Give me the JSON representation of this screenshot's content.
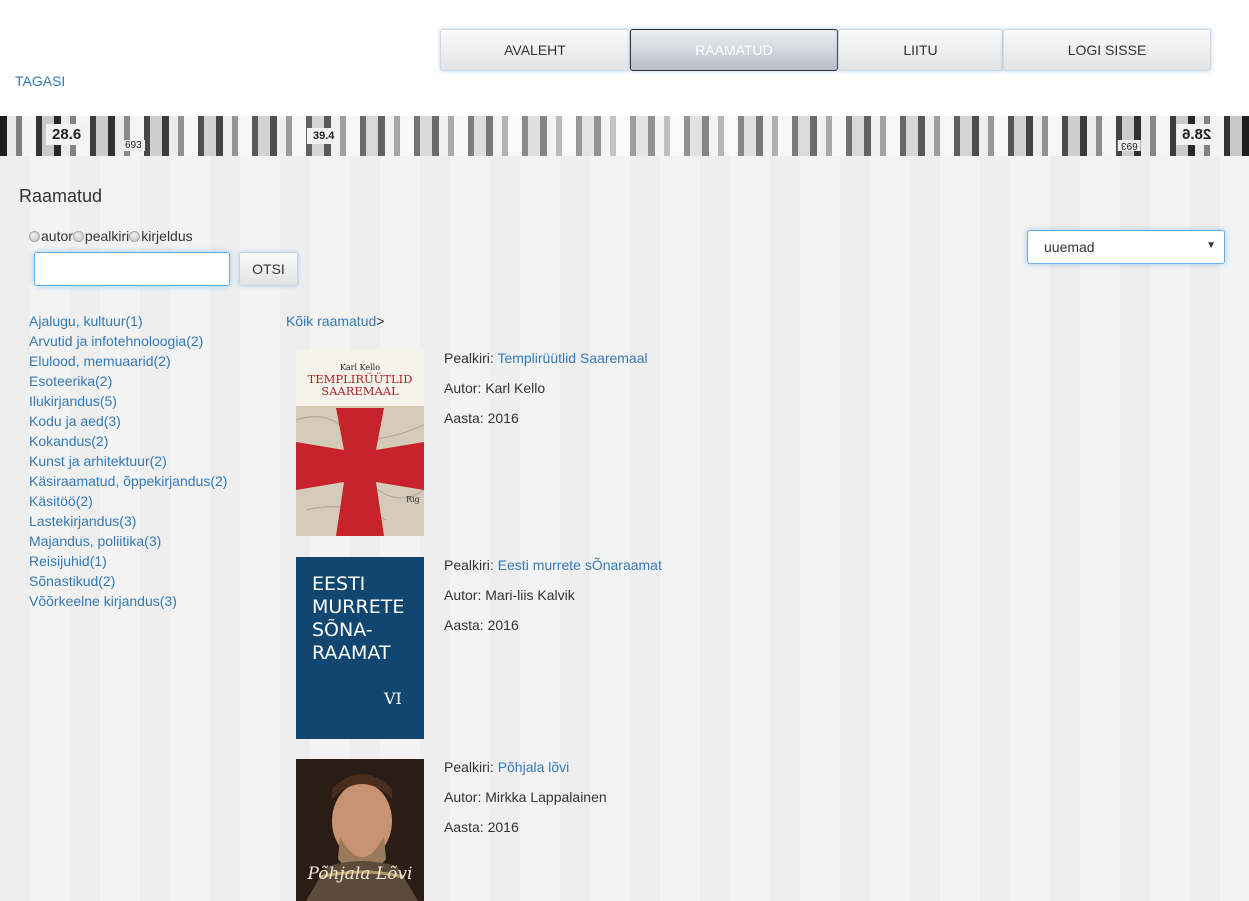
{
  "nav": {
    "items": [
      {
        "label": "AVALEHT",
        "active": false
      },
      {
        "label": "RAAMATUD",
        "active": true
      },
      {
        "label": "LIITU",
        "active": false
      },
      {
        "label": "LOGI SISSE",
        "active": false
      }
    ]
  },
  "back_link": "TAGASI",
  "banner": {
    "labels": [
      "28.6",
      "39.4",
      "28.6"
    ],
    "small": [
      "693",
      "693"
    ]
  },
  "page_title": "Raamatud",
  "search": {
    "radios": [
      "autor",
      "pealkiri",
      "kirjeldus"
    ],
    "input_value": "",
    "button_label": "OTSI"
  },
  "sort": {
    "selected": "uuemad"
  },
  "categories": [
    "Ajalugu, kultuur(1)",
    "Arvutid ja infotehnoloogia(2)",
    "Elulood, memuaarid(2)",
    "Esoteerika(2)",
    "Ilukirjandus(5)",
    "Kodu ja aed(3)",
    "Kokandus(2)",
    "Kunst ja arhitektuur(2)",
    "Käsiraamatud, õppekirjandus(2)",
    "Käsitöö(2)",
    "Lastekirjandus(3)",
    "Majandus, poliitika(3)",
    "Reisijuhid(1)",
    "Sõnastikud(2)",
    "Võõrkeelne kirjandus(3)"
  ],
  "breadcrumb": {
    "link": "Kõik raamatud",
    "separator": ">"
  },
  "books": [
    {
      "title_label": "Pealkiri:",
      "title": "Templirüütlid Saaremaal",
      "author_label": "Autor:",
      "author": "Karl Kello",
      "year_label": "Aasta:",
      "year": "2016",
      "cover": {
        "author": "Karl Kello",
        "title_line1": "TEMPLIRÜÜTLID",
        "title_line2": "SAAREMAAL",
        "corner": "Rig"
      }
    },
    {
      "title_label": "Pealkiri:",
      "title": "Eesti murrete sÕnaraamat",
      "author_label": "Autor:",
      "author": "Mari-liis Kalvik",
      "year_label": "Aasta:",
      "year": "2016",
      "cover": {
        "lines": [
          "EESTI",
          "MURRETE",
          "SÕNA-",
          "RAAMAT"
        ],
        "volume": "VI"
      }
    },
    {
      "title_label": "Pealkiri:",
      "title": "Põhjala lõvi",
      "author_label": "Autor:",
      "author": "Mirkka Lappalainen",
      "year_label": "Aasta:",
      "year": "2016",
      "cover": {
        "title": "Põhjala Lõvi"
      }
    }
  ]
}
